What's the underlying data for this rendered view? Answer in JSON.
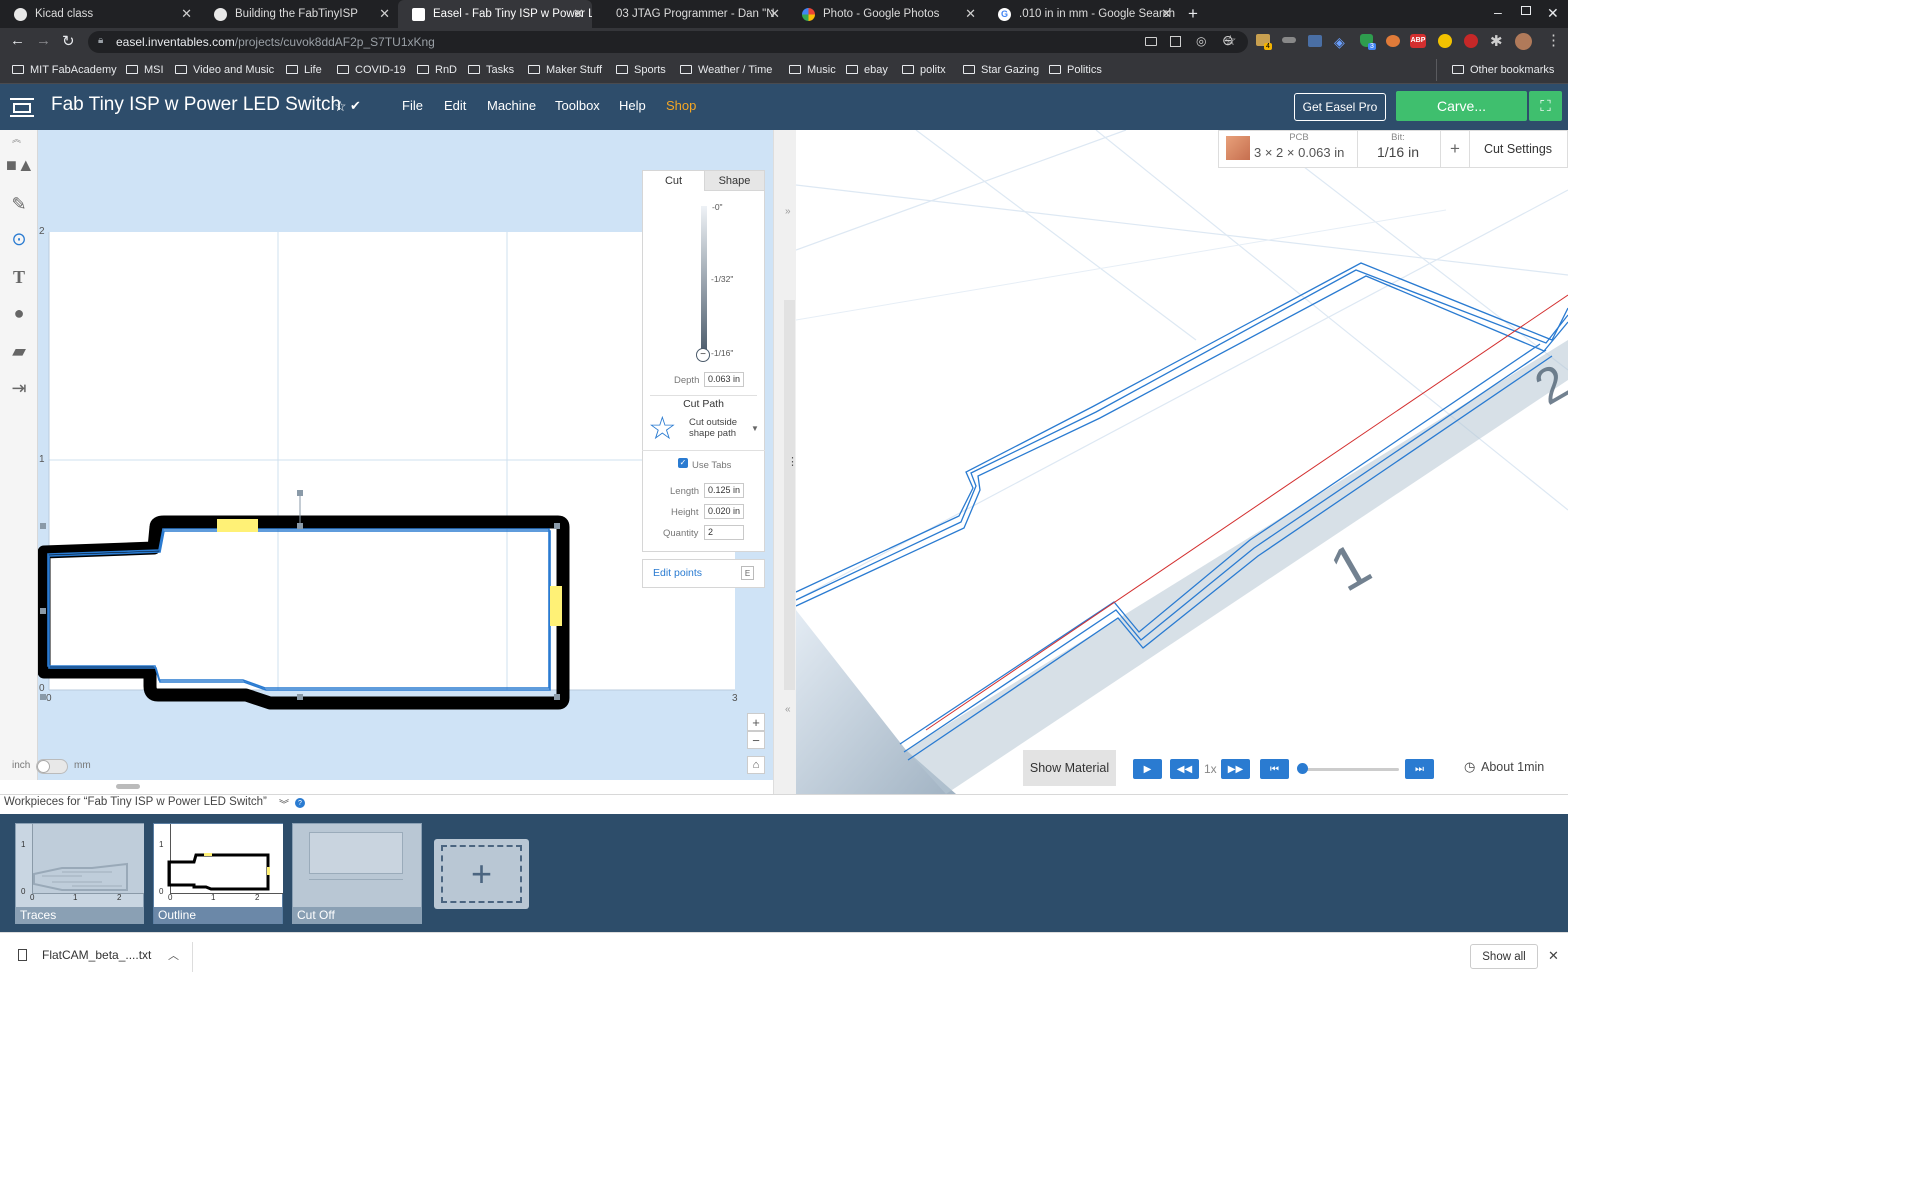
{
  "browser": {
    "tabs": [
      {
        "title": "Kicad class"
      },
      {
        "title": "Building the FabTinyISP"
      },
      {
        "title": "Easel - Fab Tiny ISP w Power L"
      },
      {
        "title": "03 JTAG Programmer - Dan \"N"
      },
      {
        "title": "Photo - Google Photos"
      },
      {
        "title": ".010 in in mm - Google Search"
      }
    ],
    "url_domain": "easel.inventables.com",
    "url_path": "/projects/cuvok8ddAF2p_S7TU1xKng",
    "bookmarks": [
      "MIT FabAcademy",
      "MSI",
      "Video and Music",
      "Life",
      "COVID-19",
      "RnD",
      "Tasks",
      "Maker Stuff",
      "Sports",
      "Weather / Time",
      "Music",
      "ebay",
      "politx",
      "Star Gazing",
      "Politics"
    ],
    "other_bookmarks": "Other bookmarks",
    "ext_badges": {
      "first": "4",
      "shield": "3",
      "abp": "ABP"
    }
  },
  "app": {
    "project_title": "Fab Tiny ISP w Power LED Switch",
    "menu": [
      "File",
      "Edit",
      "Machine",
      "Toolbox",
      "Help",
      "Shop"
    ],
    "get_pro": "Get Easel Pro",
    "carve": "Carve..."
  },
  "canvas": {
    "axis_y": [
      "2",
      "1",
      "0"
    ],
    "axis_x": [
      "0",
      "3"
    ],
    "units_left": "inch",
    "units_right": "mm"
  },
  "cut_panel": {
    "tabs": [
      "Cut",
      "Shape"
    ],
    "depth_marks": [
      "-0\"",
      "-1/32\"",
      "-1/16\""
    ],
    "depth_label": "Depth",
    "depth_value": "0.063 in",
    "cut_path_title": "Cut Path",
    "cut_path_option_line1": "Cut outside",
    "cut_path_option_line2": "shape path",
    "use_tabs": "Use Tabs",
    "length_label": "Length",
    "length_value": "0.125 in",
    "height_label": "Height",
    "height_value": "0.020 in",
    "quantity_label": "Quantity",
    "quantity_value": "2",
    "edit_points": "Edit points",
    "edit_key": "E"
  },
  "material": {
    "label": "PCB",
    "dims": "3 × 2 × 0.063 in",
    "bit_label": "Bit:",
    "bit_value": "1/16 in",
    "plus": "+",
    "cut_settings": "Cut Settings"
  },
  "sim": {
    "show_material": "Show Material",
    "speed": "1x",
    "progress": 0,
    "time_estimate": "About 1min"
  },
  "workpieces": {
    "header": "Workpieces for “Fab Tiny ISP w Power LED Switch”",
    "items": [
      {
        "label": "Traces",
        "axis_y": [
          "1",
          "0"
        ],
        "axis_x": [
          "0",
          "1",
          "2"
        ]
      },
      {
        "label": "Outline",
        "axis_y": [
          "1",
          "0"
        ],
        "axis_x": [
          "0",
          "1",
          "2"
        ]
      },
      {
        "label": "Cut Off"
      }
    ]
  },
  "download": {
    "file": "FlatCAM_beta_....txt",
    "show_all": "Show all"
  },
  "colors": {
    "header": "#2e4d6b",
    "carve": "#3fbf6e",
    "shop": "#f5a623",
    "path_blue": "#2a7bd1",
    "tab_yellow": "#fff176"
  }
}
